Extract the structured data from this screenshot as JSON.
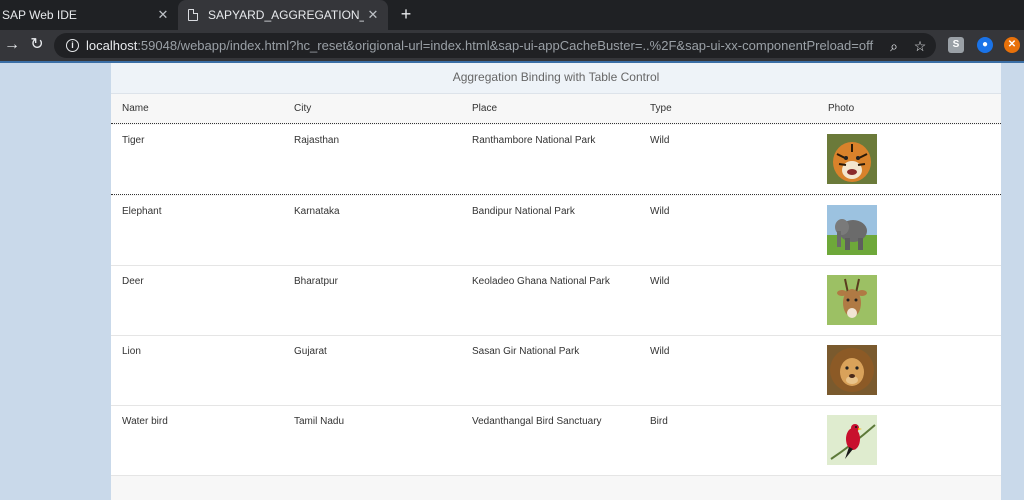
{
  "browser": {
    "tabs": [
      {
        "title": "SAP Web IDE",
        "active": false
      },
      {
        "title": "SAPYARD_AGGREGATION_BINDIN",
        "active": true
      }
    ],
    "url": {
      "host": "localhost",
      "rest": ":59048/webapp/index.html?hc_reset&origional-url=index.html&sap-ui-appCacheBuster=..%2F&sap-ui-xx-componentPreload=off"
    }
  },
  "app": {
    "title": "Aggregation Binding with Table Control",
    "columns": [
      "Name",
      "City",
      "Place",
      "Type",
      "Photo"
    ],
    "rows": [
      {
        "name": "Tiger",
        "city": "Rajasthan",
        "place": "Ranthambore National Park",
        "type": "Wild",
        "photo": "tiger-photo"
      },
      {
        "name": "Elephant",
        "city": "Karnataka",
        "place": "Bandipur National Park",
        "type": "Wild",
        "photo": "elephant-photo"
      },
      {
        "name": "Deer",
        "city": "Bharatpur",
        "place": "Keoladeo Ghana National Park",
        "type": "Wild",
        "photo": "deer-photo"
      },
      {
        "name": "Lion",
        "city": "Gujarat",
        "place": "Sasan Gir National Park",
        "type": "Wild",
        "photo": "lion-photo"
      },
      {
        "name": "Water bird",
        "city": "Tamil Nadu",
        "place": "Vedanthangal Bird Sanctuary",
        "type": "Bird",
        "photo": "bird-photo"
      }
    ]
  }
}
